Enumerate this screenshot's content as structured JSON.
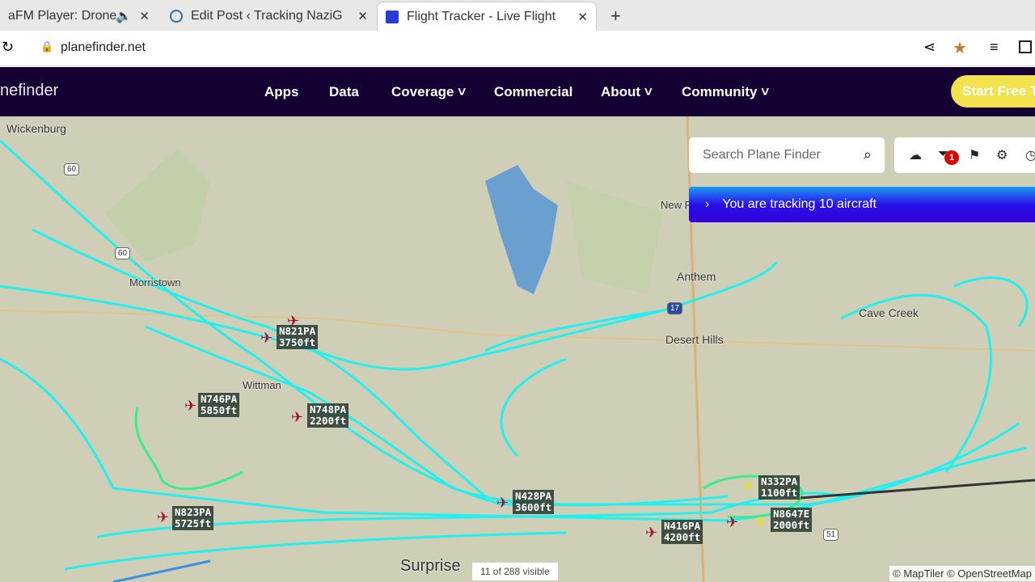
{
  "browser": {
    "tabs": [
      {
        "title": "aFM Player: Drone"
      },
      {
        "title": "Edit Post ‹ Tracking NaziG"
      },
      {
        "title": "Flight Tracker - Live Flight"
      }
    ],
    "new_tab": "+",
    "url": "planefinder.net"
  },
  "nav": {
    "logo": "nefinder",
    "items": [
      "Apps",
      "Data",
      "Coverage ˅",
      "Commercial",
      "About ˅",
      "Community ˅"
    ],
    "cta": "Start Free Tr"
  },
  "map": {
    "search_placeholder": "Search Plane Finder",
    "filter_badge": "1",
    "tracking_text": "You are tracking 10 aircraft",
    "places": [
      "Wickenburg",
      "Morristown",
      "Wittman",
      "New R",
      "Anthem",
      "Desert Hills",
      "Cave Creek",
      "Surprise"
    ],
    "shields": [
      "60",
      "60",
      "17",
      "51"
    ],
    "aircraft": [
      {
        "reg": "N821PA",
        "alt": "3750ft"
      },
      {
        "reg": "N746PA",
        "alt": "5850ft"
      },
      {
        "reg": "N748PA",
        "alt": "2200ft"
      },
      {
        "reg": "N823PA",
        "alt": "5725ft"
      },
      {
        "reg": "N428PA",
        "alt": "3600ft"
      },
      {
        "reg": "N416PA",
        "alt": "4200ft"
      },
      {
        "reg": "N332PA",
        "alt": "1100ft"
      },
      {
        "reg": "N8647E",
        "alt": "2000ft"
      }
    ],
    "visible_count": "11 of 288 visible",
    "attribution": "© MapTiler © OpenStreetMap"
  }
}
